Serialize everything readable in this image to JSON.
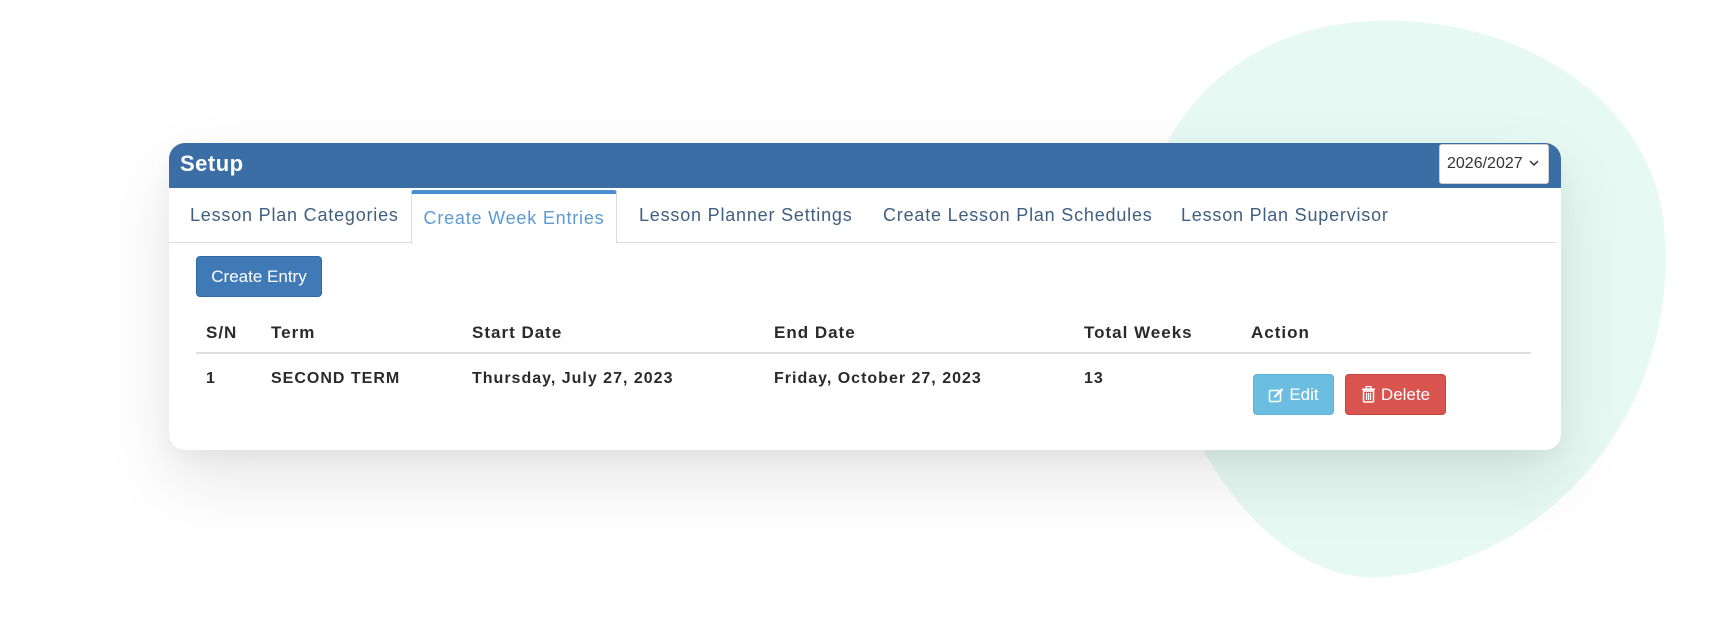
{
  "header": {
    "title": "Setup",
    "session_select": "2026/2027"
  },
  "tabs": [
    {
      "label": "Lesson Plan Categories",
      "active": false
    },
    {
      "label": "Create Week Entries",
      "active": true
    },
    {
      "label": "Lesson Planner Settings",
      "active": false
    },
    {
      "label": "Create Lesson Plan Schedules",
      "active": false
    },
    {
      "label": "Lesson Plan Supervisor",
      "active": false
    }
  ],
  "create_entry_label": "Create Entry",
  "table": {
    "columns": [
      "S/N",
      "Term",
      "Start Date",
      "End Date",
      "Total Weeks",
      "Action"
    ],
    "rows": [
      {
        "sn": "1",
        "term": "SECOND TERM",
        "start_date": "Thursday, July 27, 2023",
        "end_date": "Friday, October 27, 2023",
        "total_weeks": "13",
        "edit_label": "Edit",
        "delete_label": "Delete"
      }
    ]
  },
  "icons": {
    "edit": "edit-icon",
    "delete": "trash-icon",
    "select": "chevron-down-icon"
  },
  "colors": {
    "header": "#3b6ea5",
    "primary_button": "#3f7ab7",
    "edit_button": "#6cbee0",
    "delete_button": "#d9534f",
    "active_tab": "#4b8fd0",
    "background_blob": "#e6faf3"
  }
}
